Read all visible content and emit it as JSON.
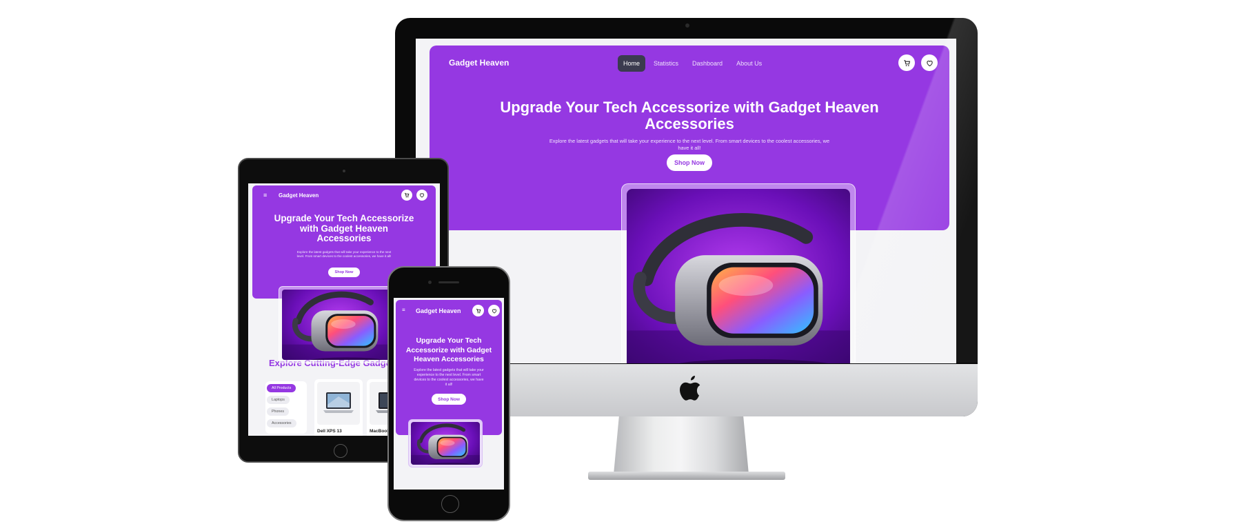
{
  "site": {
    "brand": "Gadget Heaven",
    "nav": {
      "home": "Home",
      "statistics": "Statistics",
      "dashboard": "Dashboard",
      "about": "About Us"
    },
    "hero": {
      "title": "Upgrade Your Tech Accessorize with Gadget Heaven Accessories",
      "subtitle": "Explore the latest gadgets that will take your experience to the next level. From smart devices to the coolest accessories, we have it all!",
      "cta": "Shop Now"
    },
    "explore_heading": "Explore Cutting-Edge Gadgets",
    "categories": [
      "All Products",
      "Laptops",
      "Phones",
      "Accessories"
    ],
    "products": [
      "Dell XPS 13",
      "MacBook Pro"
    ],
    "icons": {
      "menu": "menu-icon",
      "cart": "cart-icon",
      "wishlist": "heart-icon",
      "apple": "apple-logo-icon"
    }
  },
  "colors": {
    "brand_purple": "#9538e2",
    "page_bg": "#f3f3f6",
    "active_nav": "#3b3b4f",
    "device_frame": "#0a0a0a"
  }
}
